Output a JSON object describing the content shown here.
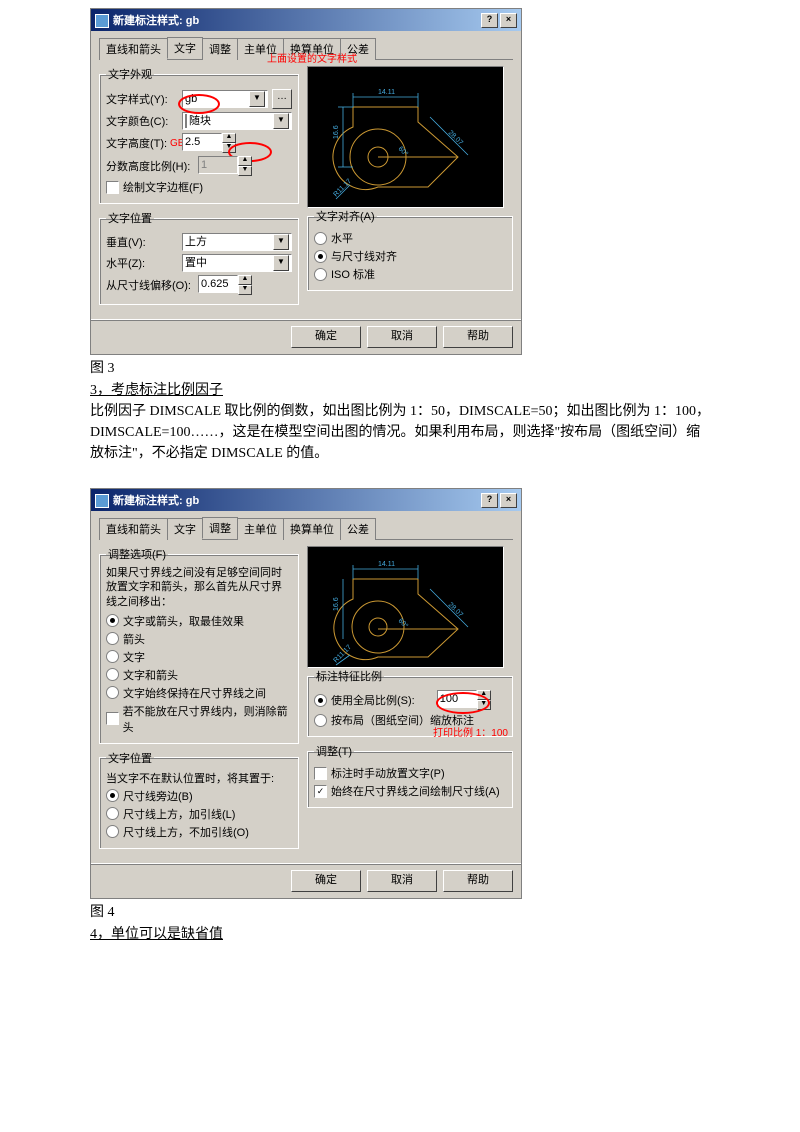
{
  "dialog1": {
    "title": "新建标注样式: gb",
    "tabs": [
      "直线和箭头",
      "文字",
      "调整",
      "主单位",
      "换算单位",
      "公差"
    ],
    "active_tab": "文字",
    "appearance": {
      "legend": "文字外观",
      "style_label": "文字样式(Y):",
      "style_value": "gb",
      "color_label": "文字颜色(C):",
      "color_value": "随块",
      "height_label": "文字高度(T):",
      "height_value": "2.5",
      "fraction_label": "分数高度比例(H):",
      "fraction_value": "1",
      "frame_label": "绘制文字边框(F)"
    },
    "position": {
      "legend": "文字位置",
      "vert_label": "垂直(V):",
      "vert_value": "上方",
      "horiz_label": "水平(Z):",
      "horiz_value": "置中",
      "offset_label": "从尺寸线偏移(O):",
      "offset_value": "0.625"
    },
    "alignment": {
      "legend": "文字对齐(A)",
      "opt1": "水平",
      "opt2": "与尺寸线对齐",
      "opt3": "ISO 标准",
      "selected": "opt2"
    },
    "annot_top": "上面设置的文字样式",
    "annot_gb": "GB：2.5~3.5",
    "buttons": {
      "ok": "确定",
      "cancel": "取消",
      "help": "帮助"
    }
  },
  "caption1": "图 3",
  "heading1": "3，考虑标注比例因子",
  "para1": "比例因子 DIMSCALE 取比例的倒数，如出图比例为 1：50，DIMSCALE=50；如出图比例为 1：100，DIMSCALE=100……，这是在模型空间出图的情况。如果利用布局，则选择\"按布局（图纸空间）缩放标注\"，不必指定 DIMSCALE 的值。",
  "dialog2": {
    "title": "新建标注样式: gb",
    "tabs": [
      "直线和箭头",
      "文字",
      "调整",
      "主单位",
      "换算单位",
      "公差"
    ],
    "active_tab": "调整",
    "fit": {
      "legend": "调整选项(F)",
      "desc": "如果尺寸界线之间没有足够空间同时放置文字和箭头，那么首先从尺寸界线之间移出：",
      "opt1": "文字或箭头，取最佳效果",
      "opt2": "箭头",
      "opt3": "文字",
      "opt4": "文字和箭头",
      "opt5": "文字始终保持在尺寸界线之间",
      "chk": "若不能放在尺寸界线内，则消除箭头",
      "selected": "opt1"
    },
    "textpos": {
      "legend": "文字位置",
      "desc": "当文字不在默认位置时，将其置于:",
      "opt1": "尺寸线旁边(B)",
      "opt2": "尺寸线上方，加引线(L)",
      "opt3": "尺寸线上方，不加引线(O)",
      "selected": "opt1"
    },
    "scale": {
      "legend": "标注特征比例",
      "opt1": "使用全局比例(S):",
      "opt2": "按布局（图纸空间）缩放标注",
      "value": "100",
      "selected": "opt1"
    },
    "tune": {
      "legend": "调整(T)",
      "chk1": "标注时手动放置文字(P)",
      "chk2": "始终在尺寸界线之间绘制尺寸线(A)"
    },
    "annot_print": "打印比例 1：100",
    "buttons": {
      "ok": "确定",
      "cancel": "取消",
      "help": "帮助"
    }
  },
  "caption2": "图 4",
  "heading2": "4，单位可以是缺省值"
}
